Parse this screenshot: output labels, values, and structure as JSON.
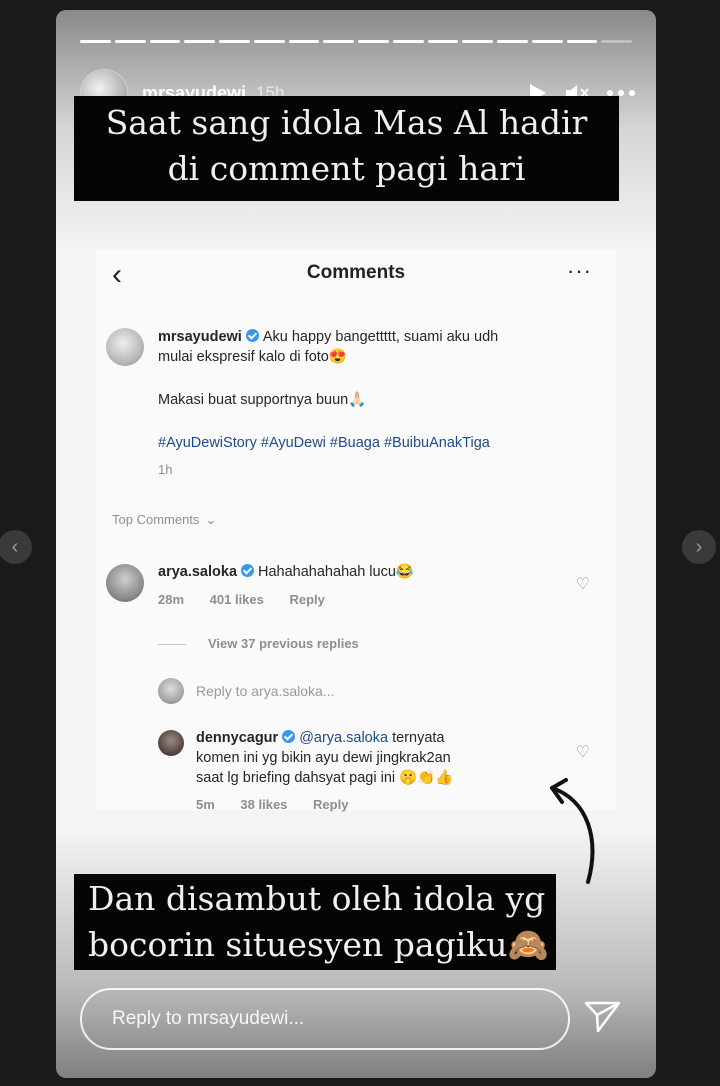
{
  "story": {
    "username": "mrsayudewi",
    "time": "15h",
    "segments": 16,
    "caption_top": [
      "Saat sang idola Mas Al hadir",
      "di comment pagi hari"
    ],
    "caption_bottom": [
      "Dan disambut oleh idola yg",
      "bocorin situesyen pagiku🙈"
    ],
    "reply_placeholder": "Reply to mrsayudewi..."
  },
  "comments_screen": {
    "title": "Comments",
    "post": {
      "username": "mrsayudewi",
      "text_1": "Aku happy bangettttt, suami aku udh",
      "text_2": "mulai ekspresif kalo di foto😍",
      "text_3": "Makasi buat supportnya buun🙏🏻",
      "hashtags": "#AyuDewiStory #AyuDewi #Buaga #BuibuAnakTiga",
      "time": "1h"
    },
    "top_comments_label": "Top Comments",
    "comment": {
      "username": "arya.saloka",
      "text": "Hahahahahahah lucu😂",
      "time": "28m",
      "likes": "401 likes",
      "reply": "Reply"
    },
    "view_replies": "View 37 previous replies",
    "reply_to": "Reply to arya.saloka...",
    "reply": {
      "username": "dennycagur",
      "mention": "@arya.saloka",
      "text_1": "ternyata",
      "text_2": "komen ini yg bikin ayu dewi jingkrak2an",
      "text_3": "saat lg briefing dahsyat pagi ini 🤫👏👍",
      "time": "5m",
      "likes": "38 likes",
      "reply": "Reply"
    }
  }
}
